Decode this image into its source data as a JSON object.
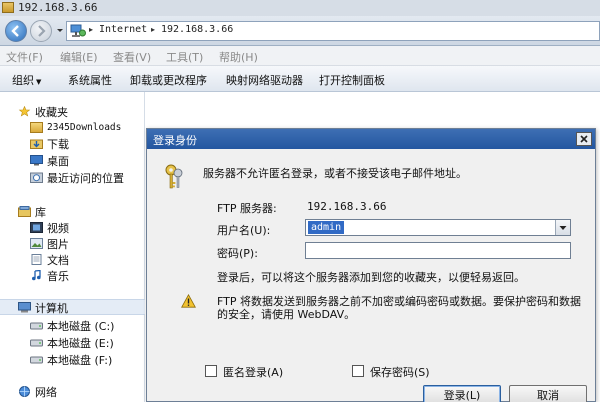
{
  "window": {
    "title": "192.168.3.66"
  },
  "address_bar": {
    "crumbs": [
      "Internet",
      "192.168.3.66"
    ],
    "separator": "▸"
  },
  "menu": [
    "文件(F)",
    "编辑(E)",
    "查看(V)",
    "工具(T)",
    "帮助(H)"
  ],
  "commands": {
    "organize": "组织",
    "organize_caret": "▼",
    "items": [
      "系统属性",
      "卸载或更改程序",
      "映射网络驱动器",
      "打开控制面板"
    ]
  },
  "nav_pane": {
    "favorites": {
      "label": "收藏夹",
      "items": [
        "2345Downloads",
        "下载",
        "桌面",
        "最近访问的位置"
      ]
    },
    "libraries": {
      "label": "库",
      "items": [
        "视频",
        "图片",
        "文档",
        "音乐"
      ]
    },
    "computer": {
      "label": "计算机",
      "drives": [
        "本地磁盘 (C:)",
        "本地磁盘 (E:)",
        "本地磁盘 (F:)"
      ]
    },
    "network": {
      "label": "网络"
    }
  },
  "dialog": {
    "title": "登录身份",
    "message": "服务器不允许匿名登录，或者不接受该电子邮件地址。",
    "server_label": "FTP 服务器:",
    "server_value": "192.168.3.66",
    "username_label": "用户名(U):",
    "username_value": "admin",
    "password_label": "密码(P):",
    "password_value": "",
    "info_text": "登录后，可以将这个服务器添加到您的收藏夹，以便轻易返回。",
    "warning_line1": "FTP 将数据发送到服务器之前不加密或编码密码或数据。要保护密码和数据",
    "warning_line2": "的安全，请使用 WebDAV。",
    "anonymous_label": "匿名登录(A)",
    "save_password_label": "保存密码(S)",
    "login_button": "登录(L)",
    "cancel_button": "取消"
  },
  "colors": {
    "dialog_title_bar": "#2356a0",
    "selection": "#316ac5",
    "warning": "#f2c230"
  }
}
